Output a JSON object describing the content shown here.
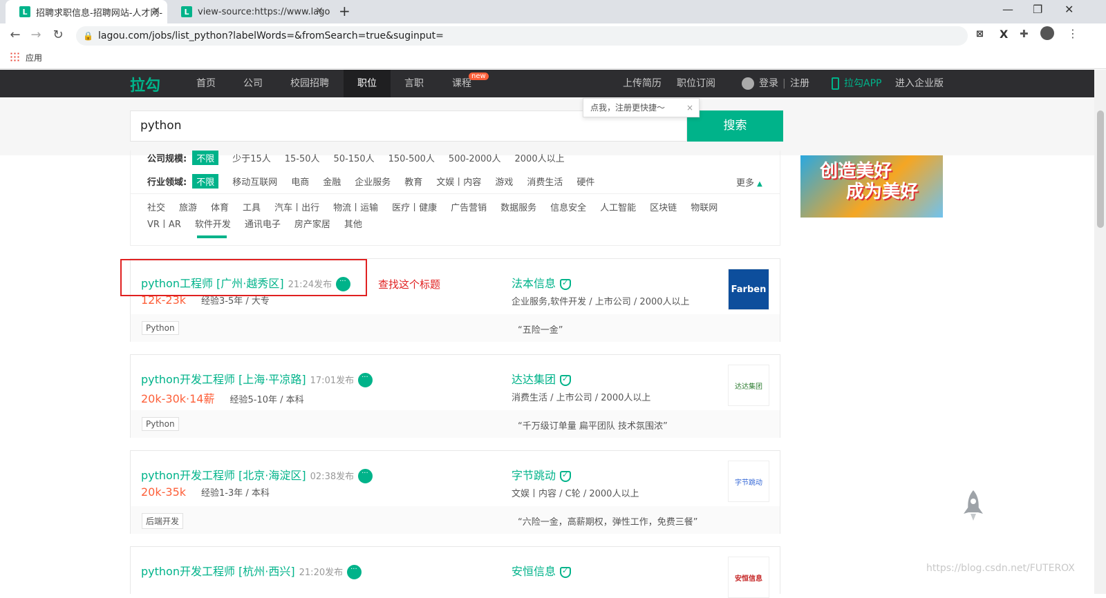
{
  "browser": {
    "tabs": [
      {
        "title": "招聘求职信息-招聘网站-人才网-",
        "favicon": "L"
      },
      {
        "title": "view-source:https://www.lago",
        "favicon": "L"
      }
    ],
    "new_tab": "+",
    "url": "lagou.com/jobs/list_python?labelWords=&fromSearch=true&suginput=",
    "bookmarks_label": "应用"
  },
  "site": {
    "logo": "拉勾",
    "nav": [
      "首页",
      "公司",
      "校园招聘",
      "职位",
      "言职",
      "课程"
    ],
    "new_badge": "new",
    "right": {
      "upload": "上传简历",
      "subscribe": "职位订阅",
      "login": "登录",
      "divider": "|",
      "register": "注册",
      "app": "拉勾APP",
      "enterprise": "进入企业版"
    },
    "tooltip": "点我，注册更快捷～",
    "search_value": "python",
    "search_button": "搜索"
  },
  "filters": {
    "scale_label": "公司规模:",
    "scale_options": [
      "不限",
      "少于15人",
      "15-50人",
      "50-150人",
      "150-500人",
      "500-2000人",
      "2000人以上"
    ],
    "industry_label": "行业领域:",
    "industry_row1": [
      "不限",
      "移动互联网",
      "电商",
      "金融",
      "企业服务",
      "教育",
      "文娱丨内容",
      "游戏",
      "消费生活",
      "硬件"
    ],
    "more": "更多",
    "industry_row2": [
      "社交",
      "旅游",
      "体育",
      "工具",
      "汽车丨出行",
      "物流丨运输",
      "医疗丨健康",
      "广告营销",
      "数据服务",
      "信息安全",
      "人工智能",
      "区块链",
      "物联网"
    ],
    "industry_row3": [
      "VR丨AR",
      "软件开发",
      "通讯电子",
      "房产家居",
      "其他"
    ]
  },
  "jobs": [
    {
      "title": "python工程师 [广州·越秀区]",
      "time": "21:24发布",
      "salary": "12k-23k",
      "req": "经验3-5年 / 大专",
      "tag": "Python",
      "company": "法本信息",
      "industry": "企业服务,软件开发 / 上市公司 / 2000人以上",
      "slogan": "“五险一金”",
      "logo": "Farben"
    },
    {
      "title": "python开发工程师 [上海·平凉路]",
      "time": "17:01发布",
      "salary": "20k-30k·14薪",
      "req": "经验5-10年 / 本科",
      "tag": "Python",
      "company": "达达集团",
      "industry": "消费生活 / 上市公司 / 2000人以上",
      "slogan": "“千万级订单量 扁平团队 技术氛围浓”",
      "logo": "达达集团"
    },
    {
      "title": "python开发工程师 [北京·海淀区]",
      "time": "02:38发布",
      "salary": "20k-35k",
      "req": "经验1-3年 / 本科",
      "tag": "后端开发",
      "company": "字节跳动",
      "industry": "文娱丨内容 / C轮 / 2000人以上",
      "slogan": "“六险一金，高薪期权，弹性工作，免费三餐”",
      "logo": "字节跳动"
    },
    {
      "title": "python开发工程师 [杭州·西兴]",
      "time": "21:20发布",
      "salary": "",
      "req": "",
      "tag": "",
      "company": "安恒信息",
      "industry": "",
      "slogan": "",
      "logo": "安恒信息"
    }
  ],
  "annotation": "查找这个标题",
  "banner": {
    "line1": "创造美好",
    "line2": "成为美好"
  },
  "watermark": "https://blog.csdn.net/FUTEROX"
}
